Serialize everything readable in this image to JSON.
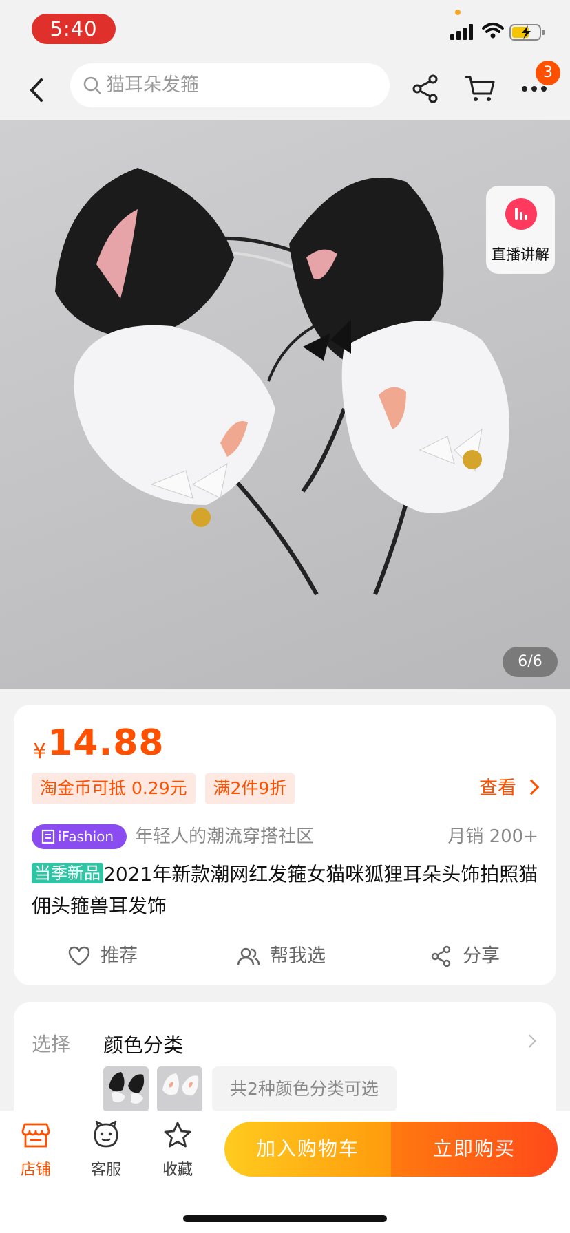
{
  "status_bar": {
    "time": "5:40"
  },
  "nav": {
    "search_placeholder": "猫耳朵发箍",
    "more_badge_count": "3"
  },
  "gallery": {
    "live_label": "直播讲解",
    "counter": "6/6"
  },
  "product": {
    "price_symbol": "¥",
    "price": "14.88",
    "coupons": [
      "淘金币可抵 0.29元",
      "满2件9折"
    ],
    "view_link": "查看",
    "brand_badge": "iFashion",
    "brand_slogan": "年轻人的潮流穿搭社区",
    "monthly_sales": "月销 200+",
    "season_tag": "当季新品",
    "title": "2021年新款潮网红发箍女猫咪狐狸耳朵头饰拍照猫佣头箍兽耳发饰",
    "actions": {
      "recommend": "推荐",
      "help_choose": "帮我选",
      "share": "分享"
    }
  },
  "options": {
    "label": "选择",
    "title": "颜色分类",
    "count_text": "共2种颜色分类可选"
  },
  "bottom_bar": {
    "store": "店铺",
    "service": "客服",
    "favorite": "收藏",
    "add_to_cart": "加入购物车",
    "buy_now": "立即购买"
  },
  "colors": {
    "accent": "#ff5000",
    "time_pill": "#e0302b",
    "brand_purple": "#8a4cf0",
    "season_green": "#2fc4a4"
  },
  "icons": [
    "back-icon",
    "search-icon",
    "share-icon",
    "cart-icon",
    "more-icon",
    "live-icon",
    "heart-icon",
    "users-icon",
    "store-icon",
    "service-icon",
    "star-icon"
  ]
}
